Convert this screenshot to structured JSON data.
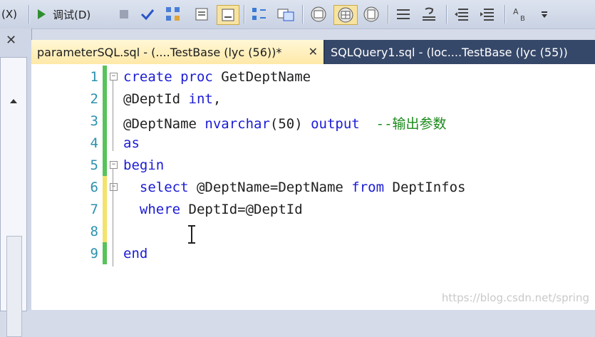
{
  "toolbar": {
    "menu_fragment": "(X)",
    "debug_label": "调试(D)",
    "icons": [
      "execute-icon",
      "stop-icon",
      "parse-check-icon",
      "query-plan-icon",
      "results-to-icon",
      "save-results-icon",
      "display-plan-icon",
      "include-stats-icon",
      "client-stats-icon",
      "results-text-icon",
      "results-grid-icon",
      "results-file-icon",
      "comment-icon",
      "uncomment-icon",
      "decrease-indent-icon",
      "increase-indent-icon",
      "specify-values-icon",
      "dropdown-icon"
    ]
  },
  "tabs": [
    {
      "label": "parameterSQL.sql - (....TestBase (lyc (56))*",
      "close": "✕",
      "active": true
    },
    {
      "label": "SQLQuery1.sql - (loc....TestBase (lyc (55))",
      "active": false
    }
  ],
  "left": {
    "close": "✕"
  },
  "editor": {
    "lines": [
      {
        "n": "1",
        "tokens": [
          {
            "t": "create proc ",
            "c": "kw"
          },
          {
            "t": "GetDeptName",
            "c": "id"
          }
        ],
        "fold": "⊟"
      },
      {
        "n": "2",
        "tokens": [
          {
            "t": "@DeptId ",
            "c": "id"
          },
          {
            "t": "int",
            "c": "kw"
          },
          {
            "t": ",",
            "c": "id"
          }
        ]
      },
      {
        "n": "3",
        "tokens": [
          {
            "t": "@DeptName ",
            "c": "id"
          },
          {
            "t": "nvarchar",
            "c": "kw"
          },
          {
            "t": "(50) ",
            "c": "num"
          },
          {
            "t": "output",
            "c": "kw"
          },
          {
            "t": "  --输出参数",
            "c": "cmt"
          }
        ]
      },
      {
        "n": "4",
        "tokens": [
          {
            "t": "as",
            "c": "kw"
          }
        ]
      },
      {
        "n": "5",
        "tokens": [
          {
            "t": "begin",
            "c": "kw"
          }
        ],
        "fold": "⊟"
      },
      {
        "n": "6",
        "tokens": [
          {
            "t": "  select ",
            "c": "kw"
          },
          {
            "t": "@DeptName=DeptName ",
            "c": "id"
          },
          {
            "t": "from ",
            "c": "kw"
          },
          {
            "t": "DeptInfos",
            "c": "id"
          }
        ],
        "fold": "⊟"
      },
      {
        "n": "7",
        "tokens": [
          {
            "t": "  where ",
            "c": "kw"
          },
          {
            "t": "DeptId=@DeptId",
            "c": "id"
          }
        ]
      },
      {
        "n": "8",
        "tokens": []
      },
      {
        "n": "9",
        "tokens": [
          {
            "t": "end",
            "c": "kw"
          }
        ]
      }
    ]
  },
  "watermark": "https://blog.csdn.net/spring",
  "colors": {
    "keyword": "#1b1bd6",
    "comment": "#1a8a1a",
    "line_number": "#2b91af",
    "changed": "#58c35a",
    "unsaved": "#f3e36b",
    "tab_active": "#ffe9a8",
    "tab_inactive": "#364869"
  }
}
